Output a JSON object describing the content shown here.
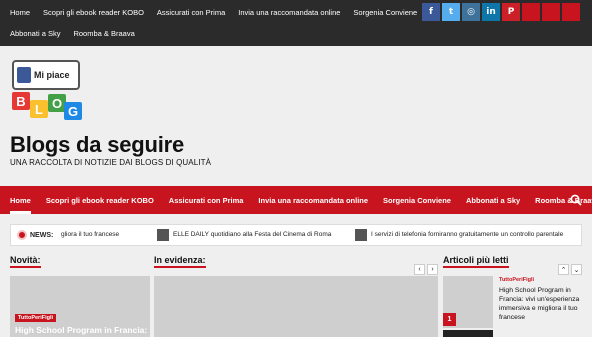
{
  "topbar": {
    "links_row1": [
      "Home",
      "Scopri gli ebook reader KOBO",
      "Assicurati con Prima",
      "Invia una raccomandata online",
      "Sorgenia Conviene"
    ],
    "links_row2": [
      "Abbonati a Sky",
      "Roomba & Braava"
    ],
    "social": [
      {
        "icon": "facebook-icon",
        "glyph": "f",
        "color": "#3b5998"
      },
      {
        "icon": "twitter-icon",
        "glyph": "t",
        "color": "#55acee"
      },
      {
        "icon": "instagram-icon",
        "glyph": "◎",
        "color": "#3f729b"
      },
      {
        "icon": "linkedin-icon",
        "glyph": "in",
        "color": "#0e76a8"
      },
      {
        "icon": "pinterest-icon",
        "glyph": "P",
        "color": "#cb2027"
      },
      {
        "icon": "social-icon-6",
        "glyph": "",
        "color": "#c8141e"
      },
      {
        "icon": "social-icon-7",
        "glyph": "",
        "color": "#c8141e"
      },
      {
        "icon": "social-icon-8",
        "glyph": "",
        "color": "#c8141e"
      }
    ]
  },
  "header": {
    "logo_like_text": "Mi piace",
    "logo_letters": [
      "B",
      "L",
      "O",
      "G"
    ],
    "site_title": "Blogs da seguire",
    "tagline": "UNA RACCOLTA DI NOTIZIE DAI BLOGS DI QUALITÀ"
  },
  "nav": {
    "items": [
      "Home",
      "Scopri gli ebook reader KOBO",
      "Assicurati con Prima",
      "Invia una raccomandata online",
      "Sorgenia Conviene",
      "Abbonati a Sky",
      "Roomba & Braava"
    ],
    "active_index": 0
  },
  "ticker": {
    "label": "NEWS:",
    "items": [
      "gliora il tuo francese",
      "ELLE DAILY quotidiano alla Festa del Cinema di Roma",
      "I servizi di telefonia forniranno gratuitamente un controllo parentale"
    ]
  },
  "sections": {
    "novita": "Novità:",
    "evidenza": "In evidenza:",
    "piu_letti": "Articoli più letti"
  },
  "card_novita": {
    "category": "TuttoPeriFigli",
    "title": "High School Program in Francia:"
  },
  "most_read": {
    "rank": "1",
    "category": "TuttoPeriFigli",
    "title": "High School Program in Francia: vivi un'esperienza immersiva e migliora il tuo francese"
  },
  "colors": {
    "accent": "#c8141e",
    "topbar": "#2b2b2b"
  }
}
